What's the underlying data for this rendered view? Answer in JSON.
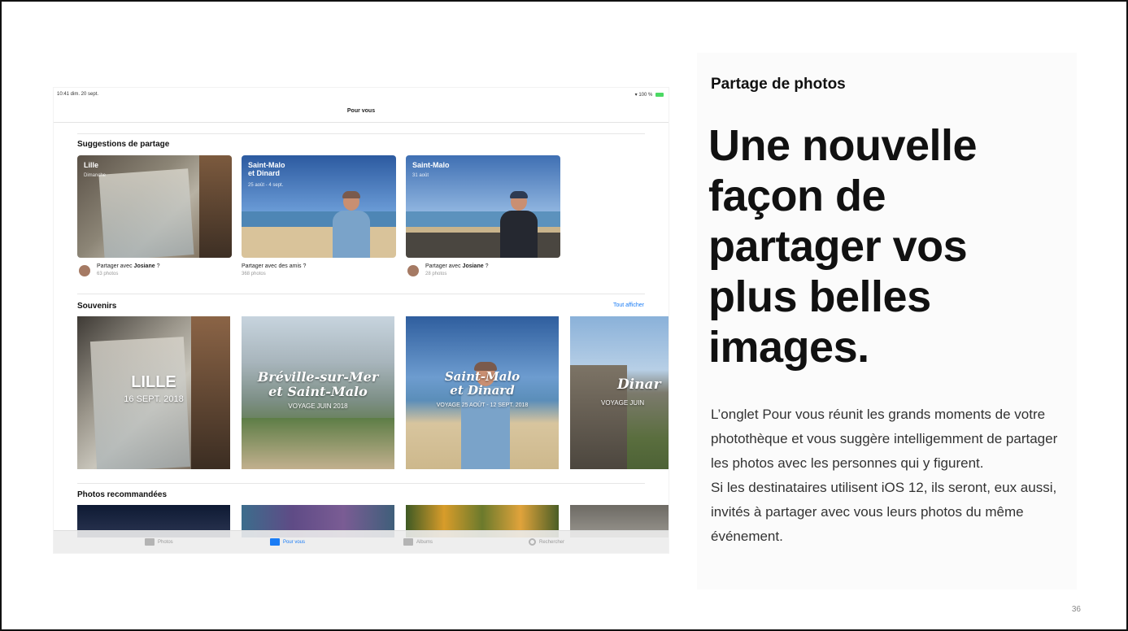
{
  "ipad": {
    "status_time": "10:41  dim. 20 sept.",
    "status_right": "100 %",
    "nav_title": "Pour vous",
    "suggestions": {
      "title": "Suggestions de partage",
      "cards": [
        {
          "title": "Lille",
          "subtitle": "Dimanche",
          "share_prefix": "Partager avec",
          "share_name": "Josiane",
          "share_suffix": " ?",
          "count": "63 photos"
        },
        {
          "title": "Saint-Malo\net Dinard",
          "subtitle": "25 août - 4 sept.",
          "share_prefix": "Partager avec des amis ?",
          "share_name": "",
          "share_suffix": "",
          "count": "368 photos"
        },
        {
          "title": "Saint-Malo",
          "subtitle": "31 août",
          "share_prefix": "Partager avec",
          "share_name": "Josiane",
          "share_suffix": " ?",
          "count": "28 photos"
        }
      ]
    },
    "souvenirs": {
      "title": "Souvenirs",
      "see_all": "Tout afficher",
      "items": [
        {
          "title": "LILLE",
          "subtitle": "16 SEPT. 2018"
        },
        {
          "title": "Bréville-sur-Mer\net Saint-Malo",
          "subtitle": "VOYAGE JUIN 2018"
        },
        {
          "title": "Saint-Malo\net Dinard",
          "subtitle": "VOYAGE 25 AOÛT - 12 SEPT. 2018"
        },
        {
          "title": "Dinar",
          "subtitle": "VOYAGE JUIN"
        }
      ]
    },
    "recommended": {
      "title": "Photos recommandées"
    },
    "tabs": [
      {
        "label": "Photos"
      },
      {
        "label": "Pour vous"
      },
      {
        "label": "Albums"
      },
      {
        "label": "Rechercher"
      }
    ]
  },
  "panel": {
    "kicker": "Partage de photos",
    "headline": "Une nouvelle façon de partager vos plus belles images.",
    "body_p1": "L’onglet Pour vous réunit les grands moments de votre photothèque et vous suggère intelligemment de partager les photos avec les personnes qui y figurent.",
    "body_p2": "Si les destinataires utilisent iOS 12, ils seront, eux aussi, invités à partager avec vous leurs photos du même événement."
  },
  "page_number": "36",
  "colors": {
    "accent_blue": "#1a7cf5",
    "battery_green": "#4cd964",
    "text_dark": "#111111"
  }
}
